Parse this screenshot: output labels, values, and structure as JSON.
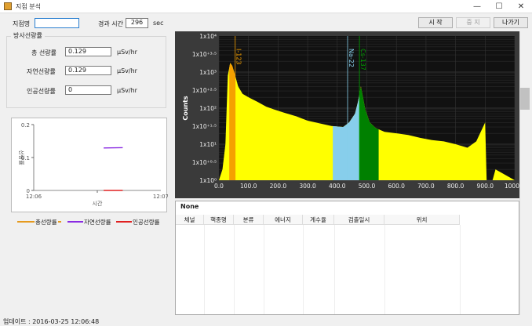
{
  "window": {
    "title": "지점 분석",
    "min": "—",
    "max": "☐",
    "close": "✕"
  },
  "top": {
    "site_label": "지점명",
    "site_value": "",
    "elapsed_label": "경과 시간",
    "elapsed_value": "296",
    "elapsed_unit": "sec"
  },
  "buttons": {
    "start": "시 작",
    "stop": "중 지",
    "exit": "나가기"
  },
  "radiation": {
    "group_title": "방사선량률",
    "total_label": "총 선량률",
    "total_value": "0.129",
    "total_unit": "μSv/hr",
    "natural_label": "자연선량률",
    "natural_value": "0.129",
    "natural_unit": "μSv/hr",
    "artificial_label": "인공선량률",
    "artificial_value": "0",
    "artificial_unit": "μSv/hr"
  },
  "trend": {
    "y_ticks": [
      "0.2",
      "0.1",
      "0"
    ],
    "ylabel": "선량률",
    "x_ticks": [
      "12:06",
      "12:07"
    ],
    "xlabel": "시간",
    "legend": [
      {
        "label": "총선량률",
        "color": "#e69a1e"
      },
      {
        "label": "자연선량률",
        "color": "#8a2be2"
      },
      {
        "label": "인공선량률",
        "color": "#e02020"
      }
    ]
  },
  "table": {
    "title": "None",
    "columns": [
      "채널",
      "핵종명",
      "분류",
      "에너지",
      "계수율",
      "검출일시",
      "위치"
    ]
  },
  "status": "업데이트 : 2016-03-25 12:06:48",
  "chart_data": {
    "type": "area",
    "title": "",
    "xlabel": "",
    "ylabel": "Counts",
    "yscale": "log",
    "xlim": [
      0,
      1000
    ],
    "ylim": [
      1,
      10000
    ],
    "x_ticks": [
      "0.0",
      "100.0",
      "200.0",
      "300.0",
      "400.0",
      "500.0",
      "600.0",
      "700.0",
      "800.0",
      "900.0",
      "1000.0"
    ],
    "y_ticks": [
      "1x10⁰",
      "1x10⁺⁰·⁵",
      "1x10¹",
      "1x10⁺¹·⁵",
      "1x10²",
      "1x10⁺²·⁵",
      "1x10³",
      "1x10⁺³·⁵",
      "1x10⁴"
    ],
    "x": [
      0,
      12,
      22,
      30,
      38,
      45,
      55,
      65,
      80,
      100,
      130,
      160,
      190,
      220,
      260,
      300,
      340,
      380,
      420,
      440,
      460,
      470,
      480,
      495,
      510,
      530,
      560,
      600,
      640,
      680,
      720,
      760,
      800,
      840,
      870,
      900,
      905,
      915,
      925,
      935,
      1000
    ],
    "y": [
      1,
      2,
      10,
      800,
      1800,
      1500,
      800,
      400,
      250,
      200,
      150,
      110,
      90,
      75,
      60,
      45,
      38,
      32,
      30,
      40,
      70,
      150,
      400,
      90,
      40,
      28,
      22,
      20,
      18,
      15,
      13,
      12,
      10,
      8,
      12,
      40,
      1,
      1,
      1,
      2,
      1
    ],
    "regions": [
      {
        "name": "I-123",
        "x_start": 35,
        "x_end": 55,
        "color": "#f5a000"
      },
      {
        "name": "Na-22",
        "x_start": 385,
        "x_end": 475,
        "color": "#87ceeb"
      },
      {
        "name": "Cs-137",
        "x_start": 475,
        "x_end": 540,
        "color": "#008000"
      }
    ],
    "markers": [
      {
        "name": "I-123",
        "x": 55,
        "color": "#f5a000"
      },
      {
        "name": "Na-22",
        "x": 435,
        "color": "#87ceeb"
      },
      {
        "name": "Cs-137",
        "x": 475,
        "color": "#00a000"
      }
    ],
    "fill_color": "#ffff00",
    "grid": true
  },
  "trend_data": {
    "type": "line",
    "xlabel": "시간",
    "ylabel": "선량률",
    "ylim": [
      0,
      0.2
    ],
    "series": [
      {
        "name": "자연선량률",
        "x": [
          0.55,
          0.7
        ],
        "y": [
          0.129,
          0.13
        ]
      },
      {
        "name": "인공선량률",
        "x": [
          0.55,
          0.7
        ],
        "y": [
          0,
          0
        ]
      }
    ]
  }
}
